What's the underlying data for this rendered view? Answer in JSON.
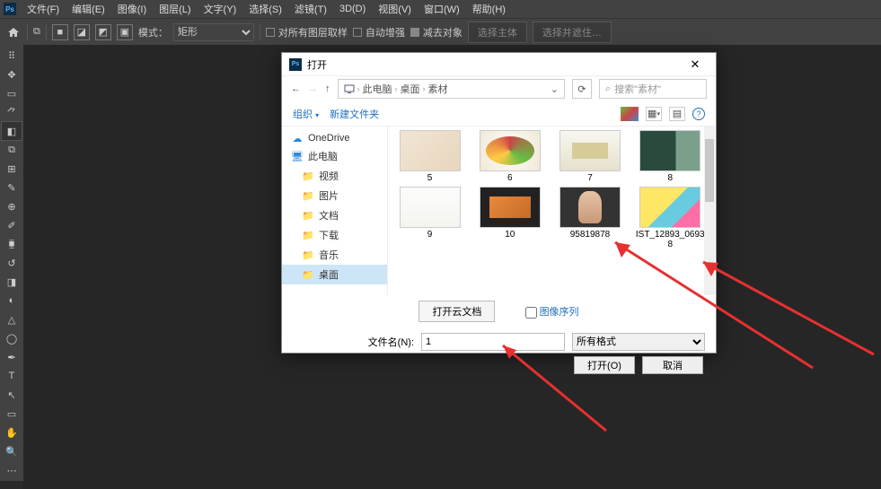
{
  "menu": {
    "file": "文件(F)",
    "edit": "编辑(E)",
    "image": "图像(I)",
    "layer": "图层(L)",
    "type": "文字(Y)",
    "select": "选择(S)",
    "filter": "滤镜(T)",
    "threeD": "3D(D)",
    "view": "视图(V)",
    "window": "窗口(W)",
    "help": "帮助(H)"
  },
  "opt": {
    "mode": "模式：",
    "shape": "矩形",
    "sample": "对所有图层取样",
    "auto": "自动增强",
    "subtract": "减去对象",
    "selSubj": "选择主体",
    "selMask": "选择并遮住…"
  },
  "dialog": {
    "title": "打开",
    "crumb": {
      "pc": "此电脑",
      "desktop": "桌面",
      "folder": "素材"
    },
    "searchPlaceholder": "搜索\"素材\"",
    "organize": "组织",
    "newFolder": "新建文件夹",
    "side": {
      "onedrive": "OneDrive",
      "pc": "此电脑",
      "video": "视频",
      "pictures": "图片",
      "docs": "文档",
      "downloads": "下载",
      "music": "音乐",
      "desktop": "桌面"
    },
    "files": [
      {
        "name": "5",
        "th": "th5"
      },
      {
        "name": "6",
        "th": "th6"
      },
      {
        "name": "7",
        "th": "th7"
      },
      {
        "name": "8",
        "th": "th8"
      },
      {
        "name": "9",
        "th": "th9"
      },
      {
        "name": "10",
        "th": "th10"
      },
      {
        "name": "95819878",
        "th": "th11"
      },
      {
        "name": "IST_12893_06938",
        "th": "th12"
      }
    ],
    "cloudBtn": "打开云文档",
    "imgSeq": "图像序列",
    "fnameLabel": "文件名(N):",
    "fnameVal": "1",
    "filter": "所有格式",
    "open": "打开(O)",
    "cancel": "取消"
  }
}
